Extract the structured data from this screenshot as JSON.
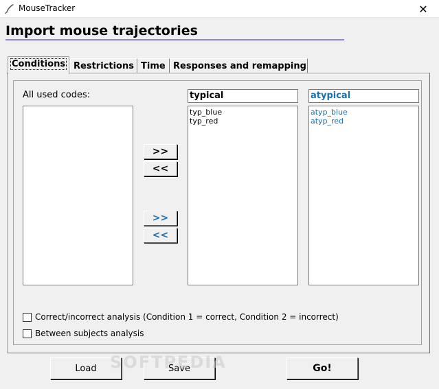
{
  "window": {
    "title": "MouseTracker",
    "app_icon": "quill-icon",
    "close_glyph": "✕"
  },
  "heading": "Import mouse trajectories",
  "tabs": [
    {
      "label": "Conditions",
      "active": true
    },
    {
      "label": "Restrictions",
      "active": false
    },
    {
      "label": "Time",
      "active": false
    },
    {
      "label": "Responses and remapping",
      "active": false
    }
  ],
  "conditions": {
    "all_codes_label": "All used codes:",
    "all_codes": [],
    "condition1": {
      "name": "typical",
      "codes": [
        "typ_blue",
        "typ_red"
      ]
    },
    "condition2": {
      "name": "atypical",
      "codes": [
        "atyp_blue",
        "atyp_red"
      ]
    },
    "move_to_1_label": ">>",
    "move_from_1_label": "<<",
    "move_to_2_label": ">>",
    "move_from_2_label": "<<",
    "options": [
      {
        "label": "Correct/incorrect analysis (Condition 1 = correct, Condition 2 = incorrect)",
        "checked": false
      },
      {
        "label": "Between subjects analysis",
        "checked": false
      }
    ]
  },
  "buttons": {
    "load": "Load",
    "save": "Save",
    "go": "Go!"
  },
  "watermark": "SOFTPEDIA",
  "colors": {
    "accent_blue": "#1b6fb3",
    "heading_underline": "#8c84d4"
  }
}
